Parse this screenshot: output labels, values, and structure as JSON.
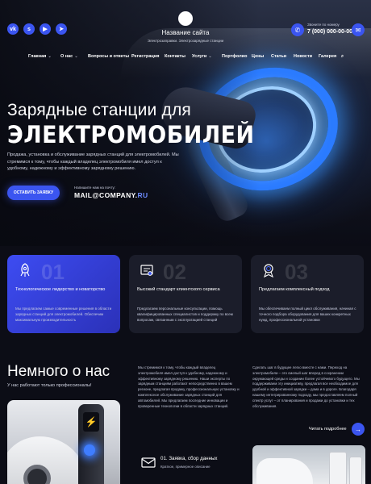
{
  "header": {
    "social": [
      {
        "icon": "vk-icon",
        "glyph": "vk"
      },
      {
        "icon": "skype-icon",
        "glyph": "s"
      },
      {
        "icon": "youtube-icon",
        "glyph": "▶"
      },
      {
        "icon": "telegram-icon",
        "glyph": "➤"
      }
    ],
    "site_title": "Название сайта",
    "site_subtitle": "Электрозаправки. Электрозарядные станции",
    "phone_label": "Звоните по номеру",
    "phone": "7 (000) 000-00-00",
    "phone_icon_glyph": "✆",
    "ask_icon_glyph": "✉"
  },
  "nav": {
    "items": [
      {
        "label": "Главная",
        "dropdown": true
      },
      {
        "label": "О нас",
        "dropdown": true
      },
      {
        "label": "Вопросы и ответы",
        "dropdown": false
      },
      {
        "label": "Регистрация",
        "dropdown": false
      },
      {
        "label": "Контакты",
        "dropdown": false
      },
      {
        "label": "Услуги",
        "dropdown": true
      },
      {
        "label": "Портфолио",
        "dropdown": false
      },
      {
        "label": "Цены",
        "dropdown": false
      },
      {
        "label": "Статьи",
        "dropdown": false
      },
      {
        "label": "Новости",
        "dropdown": false
      },
      {
        "label": "Галерея",
        "dropdown": false
      }
    ],
    "chevron_glyph": "⌄",
    "search_glyph": "⌕"
  },
  "hero": {
    "line1": "Зарядные станции для",
    "line2": "ЭЛЕКТРОМОБИЛЕЙ",
    "description": "Продажа, установка и обслуживание зарядных станций для электромобилей. Мы стремимся к тому, чтобы каждый владелец электромобиля имел доступ к удобному, надежному и эффективному зарядному решению.",
    "cta_label": "ОСТАВИТЬ ЗАЯВКУ",
    "mail_label": "Напишите нам на почту:",
    "mail_main": "MAIL@COMPANY.",
    "mail_tld": "RU"
  },
  "cards": [
    {
      "num": "01",
      "icon": "rocket-icon",
      "title": "Технологическое лидерство и новаторство",
      "description": "Мы предлагаем самые современные решения в области зарядных станций для электромобилей. Обеспечим максимальную производительность"
    },
    {
      "num": "02",
      "icon": "certificate-icon",
      "title": "Высокий стандарт клиентского сервиса",
      "description": "Предлагаем персональные консультации, помощь квалифицированных специалистов и поддержку по всем вопросам, связанным с эксплуатацией станций"
    },
    {
      "num": "03",
      "icon": "award-icon",
      "title": "Предлагаем комплексный подход",
      "description": "Мы обеспечиваем полный цикл обслуживания, начиная с точного подбора оборудования для ваших конкретных нужд, профессиональной установки"
    }
  ],
  "about": {
    "title": "Немного о нас",
    "subtitle": "У нас работают только профессионалы!",
    "col1": "Мы стремимся к тому, чтобы каждый владелец электромобиля имел доступ к удобному, надежному и эффективному зарядному решению. Наши эксперты по зарядным станциям работают непосредственно в вашем регионе, предлагая продажу, профессиональную установку и комплексное обслуживание зарядных станций для автомобилей. Мы предлагаем последние инновации и проверенные технологии в области зарядных станций.",
    "col2": "Сделать шаг в будущее легко вместе с нами. Переход на электромобили – это смелый шаг вперед в сохранении окружающей среды и создании более устойчивого будущего. Мы поддерживаем эту инициативу, предлагая все необходимое для удобной и эффективной зарядки – дома и в дороге. Благодаря нашему интегрированному подходу, мы предоставляем полный спектр услуг – от планирования и продажи до установки и тех обслуживания.",
    "more_label": "Читать подробнее",
    "more_glyph": "→"
  },
  "step": {
    "title": "01. Заявка, сбор данных",
    "subtitle": "Краткое, примерное описание"
  },
  "colors": {
    "accent": "#3b55f0",
    "background": "#0c0d16",
    "card_dark": "#1b1d2a"
  }
}
